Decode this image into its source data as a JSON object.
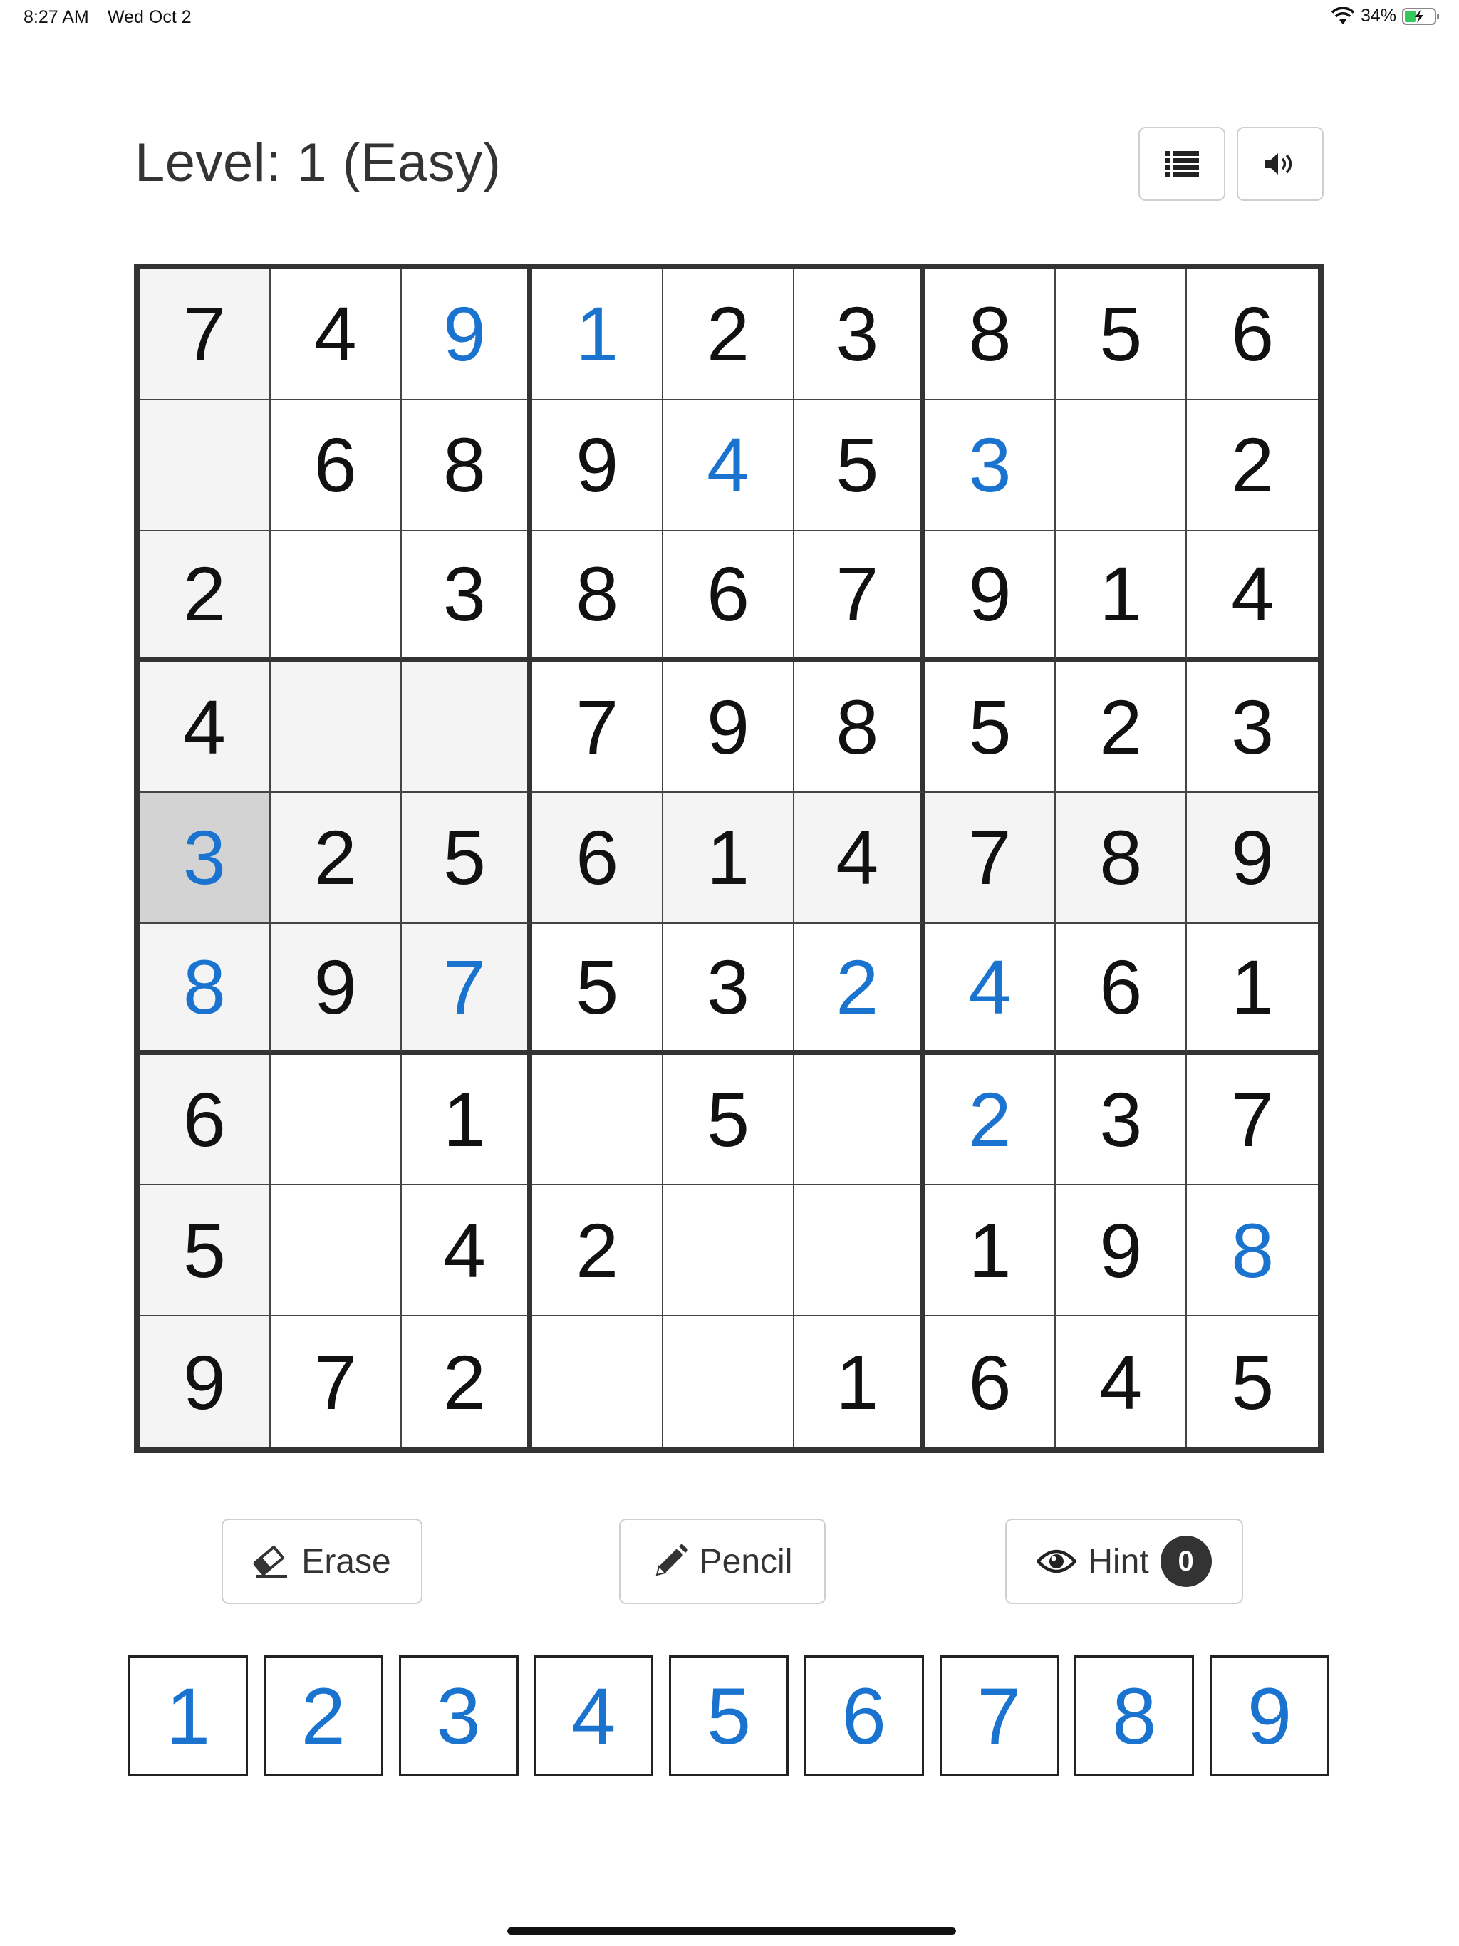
{
  "status_bar": {
    "time": "8:27 AM",
    "date": "Wed Oct 2",
    "battery": "34%"
  },
  "header": {
    "level": "Level: 1 (Easy)"
  },
  "board": {
    "cells": [
      [
        {
          "v": "7",
          "u": false
        },
        {
          "v": "4",
          "u": false
        },
        {
          "v": "9",
          "u": true
        },
        {
          "v": "1",
          "u": true
        },
        {
          "v": "2",
          "u": false
        },
        {
          "v": "3",
          "u": false
        },
        {
          "v": "8",
          "u": false
        },
        {
          "v": "5",
          "u": false
        },
        {
          "v": "6",
          "u": false
        }
      ],
      [
        {
          "v": "",
          "u": false
        },
        {
          "v": "6",
          "u": false
        },
        {
          "v": "8",
          "u": false
        },
        {
          "v": "9",
          "u": false
        },
        {
          "v": "4",
          "u": true
        },
        {
          "v": "5",
          "u": false
        },
        {
          "v": "3",
          "u": true
        },
        {
          "v": "",
          "u": false
        },
        {
          "v": "2",
          "u": false
        }
      ],
      [
        {
          "v": "2",
          "u": false
        },
        {
          "v": "",
          "u": false
        },
        {
          "v": "3",
          "u": false
        },
        {
          "v": "8",
          "u": false
        },
        {
          "v": "6",
          "u": false
        },
        {
          "v": "7",
          "u": false
        },
        {
          "v": "9",
          "u": false
        },
        {
          "v": "1",
          "u": false
        },
        {
          "v": "4",
          "u": false
        }
      ],
      [
        {
          "v": "4",
          "u": false
        },
        {
          "v": "",
          "u": false
        },
        {
          "v": "",
          "u": false
        },
        {
          "v": "7",
          "u": false
        },
        {
          "v": "9",
          "u": false
        },
        {
          "v": "8",
          "u": false
        },
        {
          "v": "5",
          "u": false
        },
        {
          "v": "2",
          "u": false
        },
        {
          "v": "3",
          "u": false
        }
      ],
      [
        {
          "v": "3",
          "u": true
        },
        {
          "v": "2",
          "u": false
        },
        {
          "v": "5",
          "u": false
        },
        {
          "v": "6",
          "u": false
        },
        {
          "v": "1",
          "u": false
        },
        {
          "v": "4",
          "u": false
        },
        {
          "v": "7",
          "u": false
        },
        {
          "v": "8",
          "u": false
        },
        {
          "v": "9",
          "u": false
        }
      ],
      [
        {
          "v": "8",
          "u": true
        },
        {
          "v": "9",
          "u": false
        },
        {
          "v": "7",
          "u": true
        },
        {
          "v": "5",
          "u": false
        },
        {
          "v": "3",
          "u": false
        },
        {
          "v": "2",
          "u": true
        },
        {
          "v": "4",
          "u": true
        },
        {
          "v": "6",
          "u": false
        },
        {
          "v": "1",
          "u": false
        }
      ],
      [
        {
          "v": "6",
          "u": false
        },
        {
          "v": "",
          "u": false
        },
        {
          "v": "1",
          "u": false
        },
        {
          "v": "",
          "u": false
        },
        {
          "v": "5",
          "u": false
        },
        {
          "v": "",
          "u": false
        },
        {
          "v": "2",
          "u": true
        },
        {
          "v": "3",
          "u": false
        },
        {
          "v": "7",
          "u": false
        }
      ],
      [
        {
          "v": "5",
          "u": false
        },
        {
          "v": "",
          "u": false
        },
        {
          "v": "4",
          "u": false
        },
        {
          "v": "2",
          "u": false
        },
        {
          "v": "",
          "u": false
        },
        {
          "v": "",
          "u": false
        },
        {
          "v": "1",
          "u": false
        },
        {
          "v": "9",
          "u": false
        },
        {
          "v": "8",
          "u": true
        }
      ],
      [
        {
          "v": "9",
          "u": false
        },
        {
          "v": "7",
          "u": false
        },
        {
          "v": "2",
          "u": false
        },
        {
          "v": "",
          "u": false
        },
        {
          "v": "",
          "u": false
        },
        {
          "v": "1",
          "u": false
        },
        {
          "v": "6",
          "u": false
        },
        {
          "v": "4",
          "u": false
        },
        {
          "v": "5",
          "u": false
        }
      ]
    ],
    "selected": {
      "row": 4,
      "col": 0
    }
  },
  "actions": {
    "erase_label": "Erase",
    "pencil_label": "Pencil",
    "hint_label": "Hint",
    "hint_count": "0"
  },
  "numpad": [
    "1",
    "2",
    "3",
    "4",
    "5",
    "6",
    "7",
    "8",
    "9"
  ],
  "colors": {
    "user_digit": "#1a73cf",
    "highlight": "#f4f4f4",
    "selected": "#d3d3d3"
  },
  "icons": {
    "list_button": "list-icon",
    "sound_button": "volume-icon",
    "erase": "eraser-icon",
    "pencil": "pencil-icon",
    "hint": "eye-icon"
  }
}
